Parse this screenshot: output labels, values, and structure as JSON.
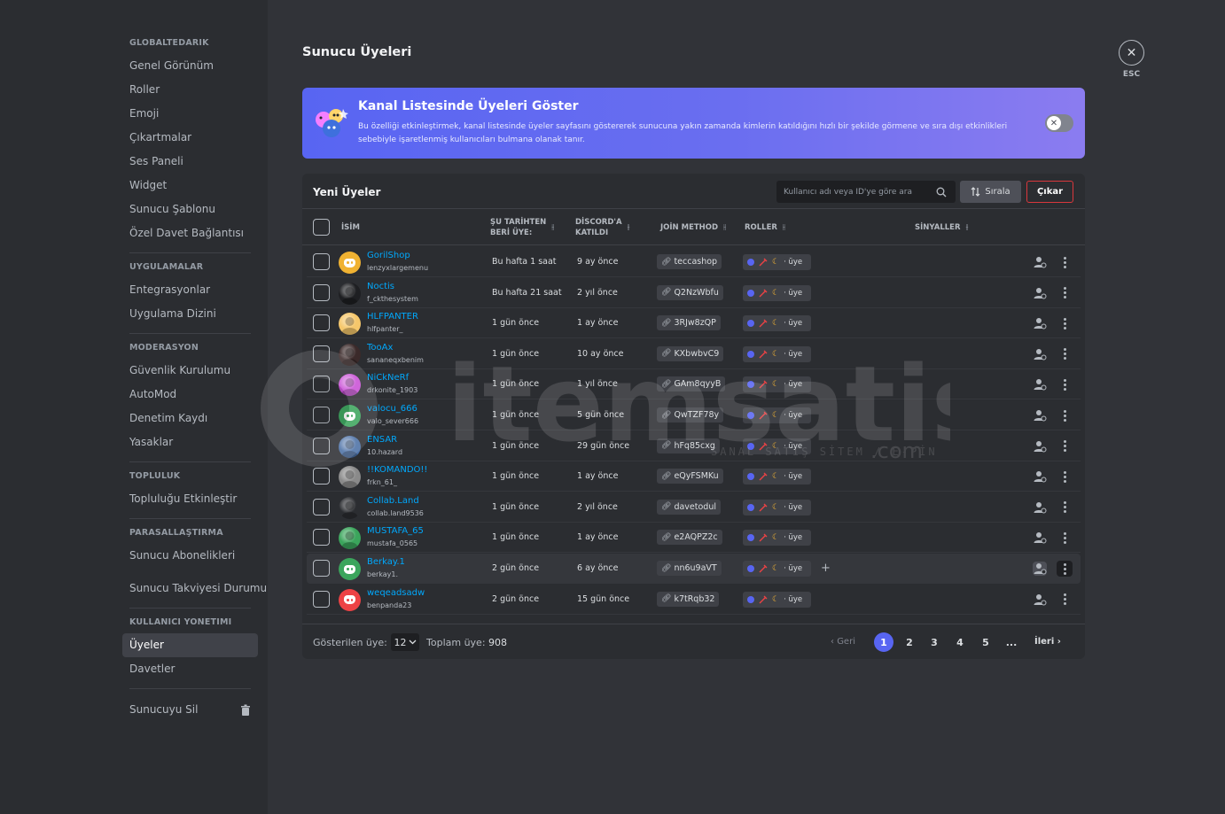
{
  "sidebar": {
    "sections": [
      {
        "title": "GLOBALTEDARİK",
        "items": [
          "Genel Görünüm",
          "Roller",
          "Emoji",
          "Çıkartmalar",
          "Ses Paneli",
          "Widget",
          "Sunucu Şablonu",
          "Özel Davet Bağlantısı"
        ]
      },
      {
        "title": "UYGULAMALAR",
        "items": [
          "Entegrasyonlar",
          "Uygulama Dizini"
        ]
      },
      {
        "title": "MODERASYON",
        "items": [
          "Güvenlik Kurulumu",
          "AutoMod",
          "Denetim Kaydı",
          "Yasaklar"
        ]
      },
      {
        "title": "TOPLULUK",
        "items": [
          "Topluluğu Etkinleştir"
        ]
      },
      {
        "title": "PARASALLAŞTIRMA",
        "items": [
          "Sunucu Abonelikleri",
          "Sunucu Takviyesi Durumu"
        ]
      },
      {
        "title": "KULLANICI YÖNETİMİ",
        "items": [
          "Üyeler",
          "Davetler"
        ]
      }
    ],
    "active_item": "Üyeler",
    "delete_label": "Sunucuyu Sil"
  },
  "header": {
    "title": "Sunucu Üyeleri",
    "esc_label": "ESC"
  },
  "banner": {
    "title": "Kanal Listesinde Üyeleri Göster",
    "description": "Bu özelliği etkinleştirmek, kanal listesinde üyeler sayfasını göstererek sunucuna yakın zamanda kimlerin katıldığını hızlı bir şekilde görmene ve sıra dışı etkinlikleri sebebiyle işaretlenmiş kullanıcıları bulmana olanak tanır.",
    "toggle_on": false
  },
  "members_card": {
    "title": "Yeni Üyeler",
    "search_placeholder": "Kullanıcı adı veya ID'ye göre ara",
    "sort_label": "Sırala",
    "kick_label": "Çıkar",
    "columns": {
      "name": "İSİM",
      "member_since_l1": "ŞU TARİHTEN",
      "member_since_l2": "BERİ ÜYE:",
      "joined_l1": "DİSCORD'A",
      "joined_l2": "KATILDI",
      "join_method": "JOİN METHOD",
      "roles": "ROLLER",
      "signals": "SİNYALLER"
    },
    "role_label": "· üye",
    "rows": [
      {
        "name": "GorilShop",
        "tag": "lenzyxlargemenu",
        "member_since": "Bu hafta 1 saat",
        "joined": "9 ay önce",
        "invite": "teccashop",
        "avatar": "#f0b232",
        "avatar_icon": "discord"
      },
      {
        "name": "Noctis",
        "tag": "f_ckthesystem",
        "member_since": "Bu hafta 21 saat",
        "joined": "2 yıl önce",
        "invite": "Q2NzWbfu",
        "avatar": "#1e1f22",
        "avatar_icon": "photo"
      },
      {
        "name": "HLFPANTER",
        "tag": "hlfpanter_",
        "member_since": "1 gün önce",
        "joined": "1 ay önce",
        "invite": "3RJw8zQP",
        "avatar": "#f5c76b",
        "avatar_icon": "photo"
      },
      {
        "name": "TooAx",
        "tag": "sananeqxbenim",
        "member_since": "1 gün önce",
        "joined": "10 ay önce",
        "invite": "KXbwbvC9",
        "avatar": "#3b2a2a",
        "avatar_icon": "photo"
      },
      {
        "name": "NiCkNeRf",
        "tag": "drkonite_1903",
        "member_since": "1 gün önce",
        "joined": "1 yıl önce",
        "invite": "GAm8qyyB",
        "avatar": "#c94fd6",
        "avatar_icon": "photo"
      },
      {
        "name": "valocu_666",
        "tag": "valo_sever666",
        "member_since": "1 gün önce",
        "joined": "5 gün önce",
        "invite": "QwTZF78y",
        "avatar": "#3ba55c",
        "avatar_icon": "discord"
      },
      {
        "name": "ENSAR",
        "tag": "10.hazard",
        "member_since": "1 gün önce",
        "joined": "29 gün önce",
        "invite": "hFq85cxg",
        "avatar": "#4a6fa5",
        "avatar_icon": "photo"
      },
      {
        "name": "!!KOMANDO!!",
        "tag": "frkn_61_",
        "member_since": "1 gün önce",
        "joined": "1 ay önce",
        "invite": "eQyFSMKu",
        "avatar": "#8a8a8a",
        "avatar_icon": "photo"
      },
      {
        "name": "Collab.Land",
        "tag": "collab.land9536",
        "member_since": "1 gün önce",
        "joined": "2 yıl önce",
        "invite": "davetodul",
        "avatar": "#2b2d31",
        "avatar_icon": "photo"
      },
      {
        "name": "MUSTAFA_65",
        "tag": "mustafa_0565",
        "member_since": "1 gün önce",
        "joined": "1 ay önce",
        "invite": "e2AQPZ2c",
        "avatar": "#3ba55c",
        "avatar_icon": "photo"
      },
      {
        "name": "Berkay.1",
        "tag": "berkay1.",
        "member_since": "2 gün önce",
        "joined": "6 ay önce",
        "invite": "nn6u9aVT",
        "avatar": "#3ba55c",
        "avatar_icon": "discord"
      },
      {
        "name": "weqeadsadw",
        "tag": "benpanda23",
        "member_since": "2 gün önce",
        "joined": "15 gün önce",
        "invite": "k7tRqb32",
        "avatar": "#ed4245",
        "avatar_icon": "discord"
      }
    ]
  },
  "pagination": {
    "shown_label": "Gösterilen üye:",
    "page_size": "12",
    "total_label": "Toplam üye:",
    "total": "908",
    "prev_label": "Geri",
    "next_label": "İleri",
    "pages": [
      "1",
      "2",
      "3",
      "4",
      "5",
      "..."
    ],
    "current": "1"
  },
  "watermark": {
    "brand": "itemsatis",
    "tld": ".com",
    "tagline": "SANAL SATIŞ SİTEM / E-PİN"
  },
  "colors": {
    "accent": "#5865f2",
    "link": "#00a8fc",
    "danger": "#da373c",
    "role_blue": "#5865f2",
    "role_red": "#ed4245",
    "moon": "#f0b232"
  }
}
